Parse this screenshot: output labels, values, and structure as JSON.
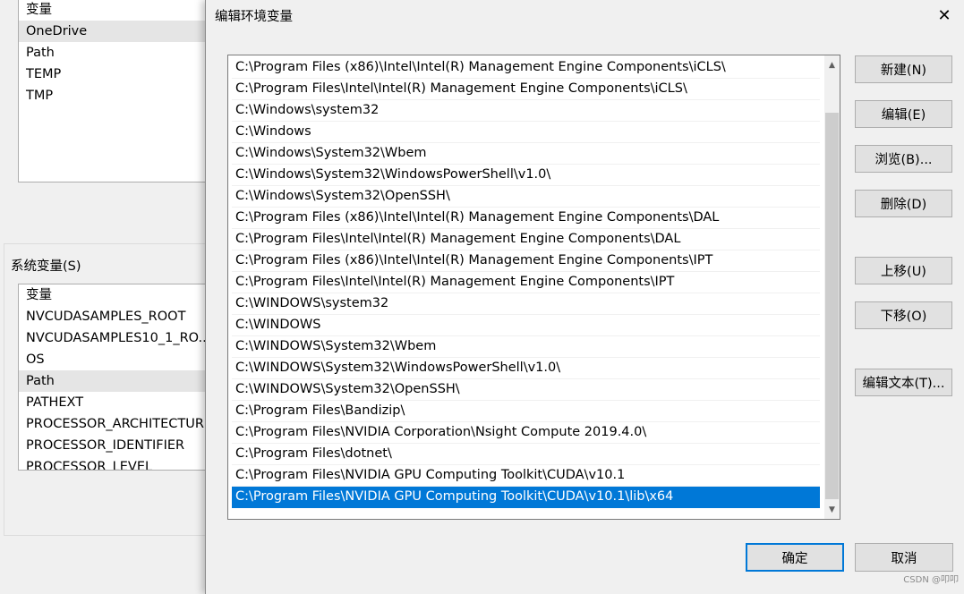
{
  "background": {
    "user_vars": {
      "header": "变量",
      "items": [
        "OneDrive",
        "Path",
        "TEMP",
        "TMP"
      ]
    },
    "system_group_label": "系统变量(S)",
    "system_vars": {
      "header": "变量",
      "items": [
        "NVCUDASAMPLES_ROOT",
        "NVCUDASAMPLES10_1_RO...",
        "OS",
        "Path",
        "PATHEXT",
        "PROCESSOR_ARCHITECTUR",
        "PROCESSOR_IDENTIFIER",
        "PROCESSOR_LEVEL"
      ]
    }
  },
  "dialog": {
    "title": "编辑环境变量",
    "close_glyph": "✕",
    "paths": [
      "C:\\Program Files (x86)\\Intel\\Intel(R) Management Engine Components\\iCLS\\",
      "C:\\Program Files\\Intel\\Intel(R) Management Engine Components\\iCLS\\",
      "C:\\Windows\\system32",
      "C:\\Windows",
      "C:\\Windows\\System32\\Wbem",
      "C:\\Windows\\System32\\WindowsPowerShell\\v1.0\\",
      "C:\\Windows\\System32\\OpenSSH\\",
      "C:\\Program Files (x86)\\Intel\\Intel(R) Management Engine Components\\DAL",
      "C:\\Program Files\\Intel\\Intel(R) Management Engine Components\\DAL",
      "C:\\Program Files (x86)\\Intel\\Intel(R) Management Engine Components\\IPT",
      "C:\\Program Files\\Intel\\Intel(R) Management Engine Components\\IPT",
      "C:\\WINDOWS\\system32",
      "C:\\WINDOWS",
      "C:\\WINDOWS\\System32\\Wbem",
      "C:\\WINDOWS\\System32\\WindowsPowerShell\\v1.0\\",
      "C:\\WINDOWS\\System32\\OpenSSH\\",
      "C:\\Program Files\\Bandizip\\",
      "C:\\Program Files\\NVIDIA Corporation\\Nsight Compute 2019.4.0\\",
      "C:\\Program Files\\dotnet\\",
      "C:\\Program Files\\NVIDIA GPU Computing Toolkit\\CUDA\\v10.1",
      "C:\\Program Files\\NVIDIA GPU Computing Toolkit\\CUDA\\v10.1\\lib\\x64"
    ],
    "selected_index": 20,
    "buttons": {
      "new": "新建(N)",
      "edit": "编辑(E)",
      "browse": "浏览(B)...",
      "delete": "删除(D)",
      "move_up": "上移(U)",
      "move_down": "下移(O)",
      "edit_text": "编辑文本(T)...",
      "ok": "确定",
      "cancel": "取消"
    },
    "accent_color": "#0078d7"
  },
  "watermark": "CSDN @叩叩"
}
